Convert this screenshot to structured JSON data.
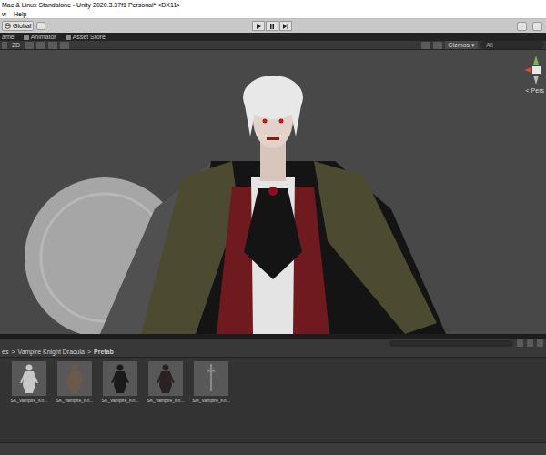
{
  "window": {
    "title": "Mac & Linux Standalone - Unity 2020.3.37f1 Personal* <DX11>"
  },
  "menu": [
    {
      "label": "w"
    },
    {
      "label": "Help"
    }
  ],
  "toolbar": {
    "pivot": "Global"
  },
  "tabs": [
    {
      "label": "ame",
      "selected": false
    },
    {
      "label": "Animator",
      "selected": false
    },
    {
      "label": "Asset Store",
      "selected": false
    }
  ],
  "scene_toolbar": {
    "mode": "2D",
    "gizmos": "Gizmos",
    "search": "All"
  },
  "gizmo": {
    "label": "< Pers"
  },
  "project": {
    "breadcrumb": [
      {
        "label": "es"
      },
      {
        "label": "Vampire Knight Dracula"
      },
      {
        "label": "Prefab"
      }
    ],
    "separator": ">",
    "assets": [
      {
        "label": "SK_Vampire_Kn...",
        "kind": "model",
        "color": "#c8c8c8"
      },
      {
        "label": "SK_Vampire_Kn...",
        "kind": "model",
        "color": "#6a5a48"
      },
      {
        "label": "SK_Vampire_Kn...",
        "kind": "model",
        "color": "#1a1a1a"
      },
      {
        "label": "SK_Vampire_Kn...",
        "kind": "model",
        "color": "#2a2222"
      },
      {
        "label": "SM_Vampire_Kn...",
        "kind": "weapon",
        "color": "#8a8a8a"
      }
    ]
  }
}
